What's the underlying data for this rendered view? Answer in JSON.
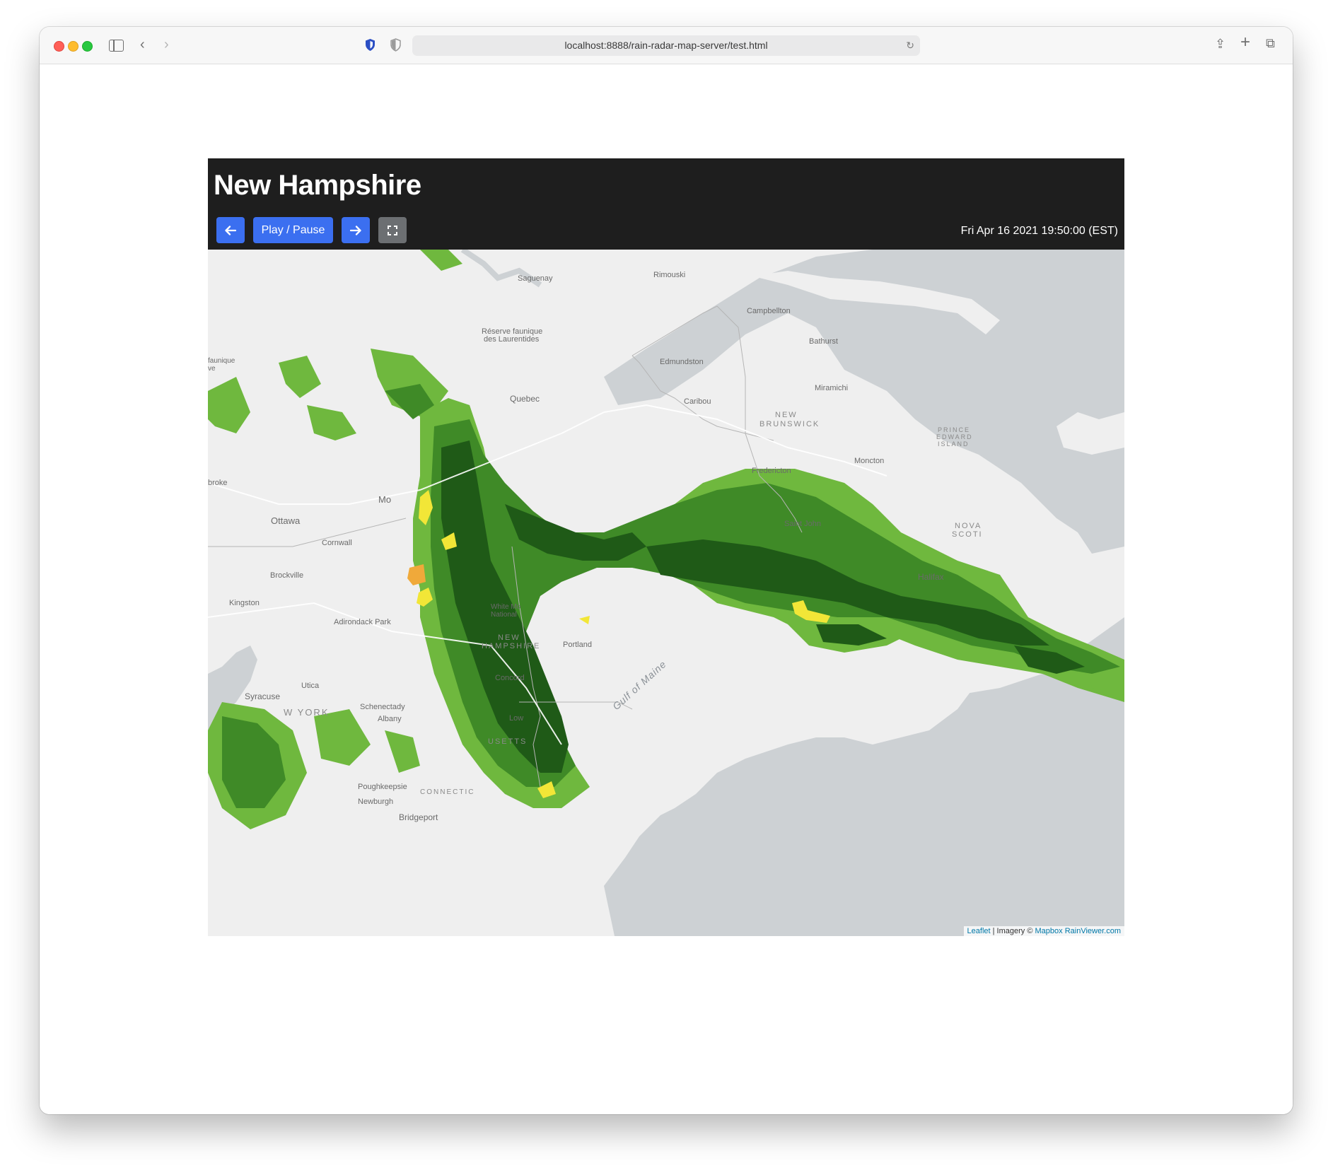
{
  "browser": {
    "url": "localhost:8888/rain-radar-map-server/test.html"
  },
  "page": {
    "title": "New Hampshire",
    "timestamp": "Fri Apr 16 2021 19:50:00 (EST)",
    "buttons": {
      "prev_icon": "arrow-left-icon",
      "play_label": "Play / Pause",
      "next_icon": "arrow-right-icon",
      "fullscreen_icon": "fullscreen-icon"
    },
    "colors": {
      "header_bg": "#1e1e1e",
      "button_blue": "#3b6ff0",
      "button_gray": "#6c6f72"
    }
  },
  "map": {
    "labels": {
      "saguenay": "Saguenay",
      "rimouski": "Rimouski",
      "campbellton": "Campbellton",
      "bathurst": "Bathurst",
      "reserve": "Réserve faunique",
      "reserve2": "des Laurentides",
      "edmundston": "Edmundston",
      "quebec": "Quebec",
      "miramichi": "Miramichi",
      "caribou": "Caribou",
      "new_brunswick1": "NEW",
      "new_brunswick2": "BRUNSWICK",
      "pei1": "PRINCE",
      "pei2": "EDWARD",
      "pei3": "ISLAND",
      "moncton": "Moncton",
      "fredericton": "Fredericton",
      "pembroke": "broke",
      "montreal": "Mo",
      "ottawa": "Ottawa",
      "saint_john": "Saint John",
      "nova_scotia1": "NOVA",
      "nova_scotia2": "SCOTI",
      "cornwall": "Cornwall",
      "brockville": "Brockville",
      "halifax": "Halifax",
      "kingston": "Kingston",
      "white_mountain1": "White Mo",
      "white_mountain2": "National",
      "adirondack": "Adirondack Park",
      "new_hampshire1": "NEW",
      "new_hampshire2": "HAMPSHIRE",
      "portland": "Portland",
      "gulf_of_maine": "Gulf of Maine",
      "concord": "Concord",
      "utica": "Utica",
      "syracuse": "Syracuse",
      "new_york": "W YORK",
      "schenectady": "Schenectady",
      "albany": "Albany",
      "lowell": "Low",
      "massachusetts": "USETTS",
      "poughkeepsie": "Poughkeepsie",
      "newburgh": "Newburgh",
      "connecticut": "CONNECTIC",
      "bridgeport": "Bridgeport",
      "faunique1": "faunique",
      "faunique2": "ve"
    },
    "attribution": {
      "leaflet": "Leaflet",
      "imagery": " | Imagery © ",
      "mapbox": "Mapbox",
      "rainviewer": "RainViewer.com"
    },
    "radar_colors": {
      "light": "#6fb83e",
      "medium": "#3f8a27",
      "dark": "#1f5a17",
      "heavy": "#f2e637",
      "intense": "#f0a93a"
    },
    "land_color": "#efefef",
    "water_color": "#cdd1d4"
  }
}
